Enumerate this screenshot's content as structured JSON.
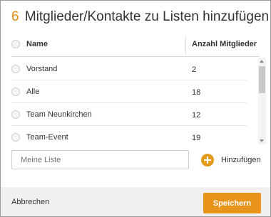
{
  "dialog": {
    "title_count": "6",
    "title_text": "Mitglieder/Kontakte zu Listen hinzufügen"
  },
  "table": {
    "columns": {
      "name": "Name",
      "count": "Anzahl Mitglieder"
    },
    "rows": [
      {
        "name": "Vorstand",
        "count": "2"
      },
      {
        "name": "Alle",
        "count": "18"
      },
      {
        "name": "Team Neunkirchen",
        "count": "12"
      },
      {
        "name": "Team-Event",
        "count": "19"
      }
    ]
  },
  "new_list": {
    "placeholder": "Meine Liste",
    "add_label": "Hinzufügen"
  },
  "footer": {
    "cancel_label": "Abbrechen",
    "save_label": "Speichern"
  },
  "colors": {
    "accent": "#e8931a",
    "footer_bg": "#f0f0f0"
  }
}
